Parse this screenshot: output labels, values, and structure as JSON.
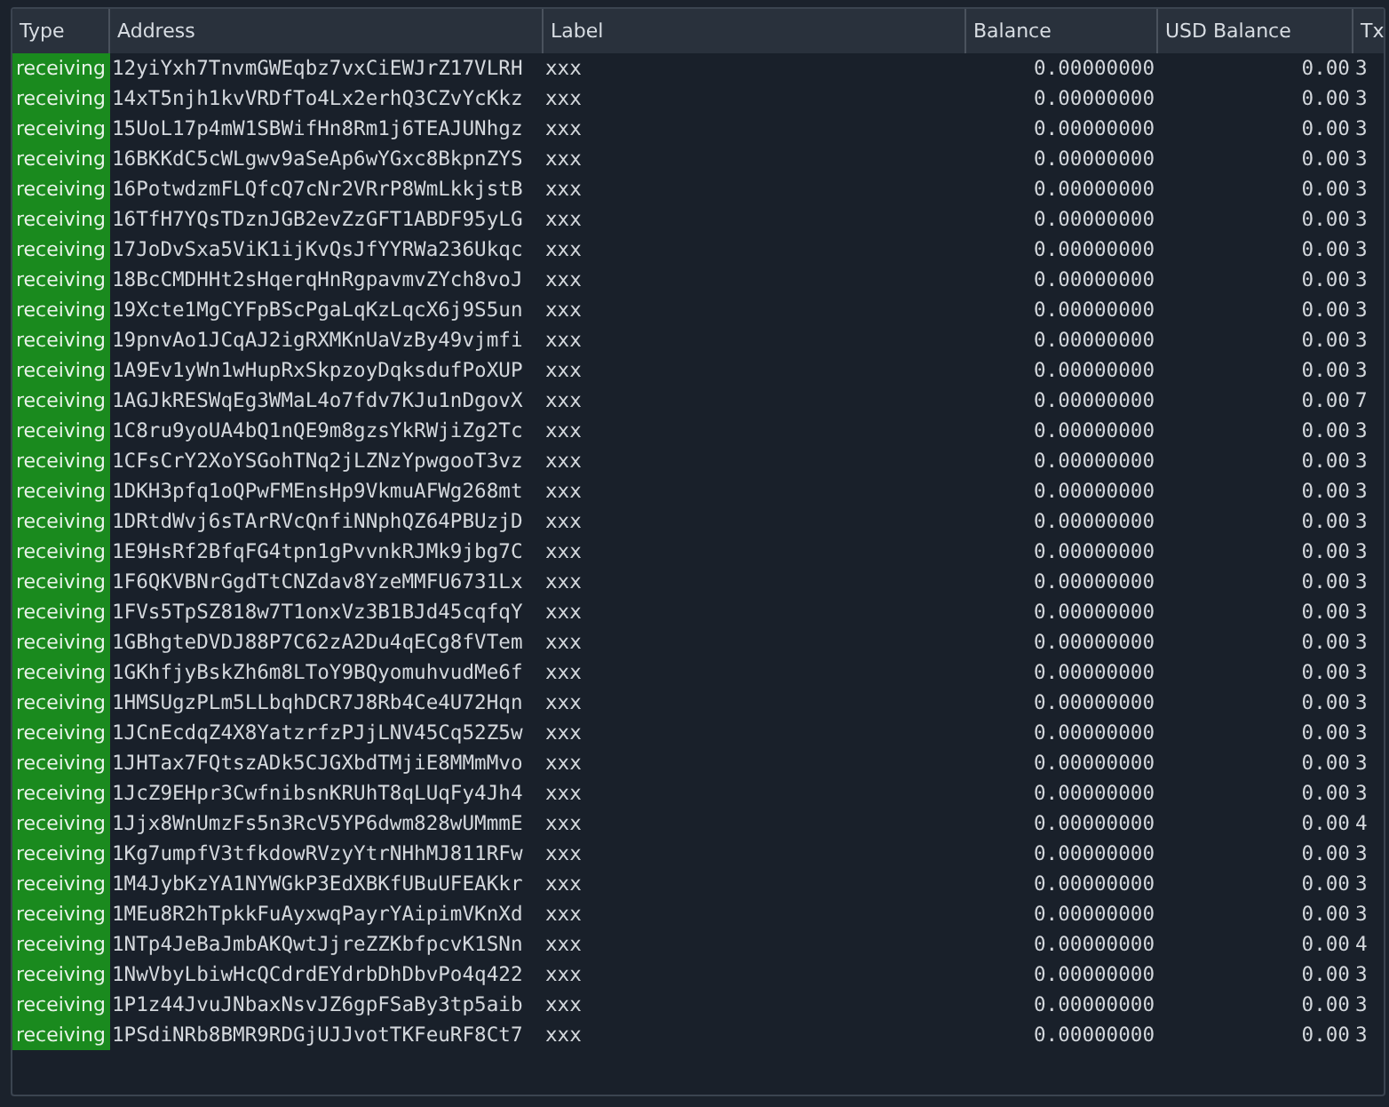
{
  "table": {
    "columns": [
      "Type",
      "Address",
      "Label",
      "Balance",
      "USD Balance",
      "Tx"
    ],
    "rows": [
      {
        "type": "receiving",
        "address": "12yiYxh7TnvmGWEqbz7vxCiEWJrZ17VLRH",
        "label": "xxx",
        "balance": "0.00000000",
        "usd_balance": "0.00",
        "tx": "3"
      },
      {
        "type": "receiving",
        "address": "14xT5njh1kvVRDfTo4Lx2erhQ3CZvYcKkz",
        "label": "xxx",
        "balance": "0.00000000",
        "usd_balance": "0.00",
        "tx": "3"
      },
      {
        "type": "receiving",
        "address": "15UoL17p4mW1SBWifHn8Rm1j6TEAJUNhgz",
        "label": "xxx",
        "balance": "0.00000000",
        "usd_balance": "0.00",
        "tx": "3"
      },
      {
        "type": "receiving",
        "address": "16BKKdC5cWLgwv9aSeAp6wYGxc8BkpnZYS",
        "label": "xxx",
        "balance": "0.00000000",
        "usd_balance": "0.00",
        "tx": "3"
      },
      {
        "type": "receiving",
        "address": "16PotwdzmFLQfcQ7cNr2VRrP8WmLkkjstB",
        "label": "xxx",
        "balance": "0.00000000",
        "usd_balance": "0.00",
        "tx": "3"
      },
      {
        "type": "receiving",
        "address": "16TfH7YQsTDznJGB2evZzGFT1ABDF95yLG",
        "label": "xxx",
        "balance": "0.00000000",
        "usd_balance": "0.00",
        "tx": "3"
      },
      {
        "type": "receiving",
        "address": "17JoDvSxa5ViK1ijKvQsJfYYRWa236Ukqc",
        "label": "xxx",
        "balance": "0.00000000",
        "usd_balance": "0.00",
        "tx": "3"
      },
      {
        "type": "receiving",
        "address": "18BcCMDHHt2sHqerqHnRgpavmvZYch8voJ",
        "label": "xxx",
        "balance": "0.00000000",
        "usd_balance": "0.00",
        "tx": "3"
      },
      {
        "type": "receiving",
        "address": "19Xcte1MgCYFpBScPgaLqKzLqcX6j9S5un",
        "label": "xxx",
        "balance": "0.00000000",
        "usd_balance": "0.00",
        "tx": "3"
      },
      {
        "type": "receiving",
        "address": "19pnvAo1JCqAJ2igRXMKnUaVzBy49vjmfi",
        "label": "xxx",
        "balance": "0.00000000",
        "usd_balance": "0.00",
        "tx": "3"
      },
      {
        "type": "receiving",
        "address": "1A9Ev1yWn1wHupRxSkpzoyDqksdufPoXUP",
        "label": "xxx",
        "balance": "0.00000000",
        "usd_balance": "0.00",
        "tx": "3"
      },
      {
        "type": "receiving",
        "address": "1AGJkRESWqEg3WMaL4o7fdv7KJu1nDgovX",
        "label": "xxx",
        "balance": "0.00000000",
        "usd_balance": "0.00",
        "tx": "7"
      },
      {
        "type": "receiving",
        "address": "1C8ru9yoUA4bQ1nQE9m8gzsYkRWjiZg2Tc",
        "label": "xxx",
        "balance": "0.00000000",
        "usd_balance": "0.00",
        "tx": "3"
      },
      {
        "type": "receiving",
        "address": "1CFsCrY2XoYSGohTNq2jLZNzYpwgooT3vz",
        "label": "xxx",
        "balance": "0.00000000",
        "usd_balance": "0.00",
        "tx": "3"
      },
      {
        "type": "receiving",
        "address": "1DKH3pfq1oQPwFMEnsHp9VkmuAFWg268mt",
        "label": "xxx",
        "balance": "0.00000000",
        "usd_balance": "0.00",
        "tx": "3"
      },
      {
        "type": "receiving",
        "address": "1DRtdWvj6sTArRVcQnfiNNphQZ64PBUzjD",
        "label": "xxx",
        "balance": "0.00000000",
        "usd_balance": "0.00",
        "tx": "3"
      },
      {
        "type": "receiving",
        "address": "1E9HsRf2BfqFG4tpn1gPvvnkRJMk9jbg7C",
        "label": "xxx",
        "balance": "0.00000000",
        "usd_balance": "0.00",
        "tx": "3"
      },
      {
        "type": "receiving",
        "address": "1F6QKVBNrGgdTtCNZdav8YzeMMFU6731Lx",
        "label": "xxx",
        "balance": "0.00000000",
        "usd_balance": "0.00",
        "tx": "3"
      },
      {
        "type": "receiving",
        "address": "1FVs5TpSZ818w7T1onxVz3B1BJd45cqfqY",
        "label": "xxx",
        "balance": "0.00000000",
        "usd_balance": "0.00",
        "tx": "3"
      },
      {
        "type": "receiving",
        "address": "1GBhgteDVDJ88P7C62zA2Du4qECg8fVTem",
        "label": "xxx",
        "balance": "0.00000000",
        "usd_balance": "0.00",
        "tx": "3"
      },
      {
        "type": "receiving",
        "address": "1GKhfjyBskZh6m8LToY9BQyomuhvudMe6f",
        "label": "xxx",
        "balance": "0.00000000",
        "usd_balance": "0.00",
        "tx": "3"
      },
      {
        "type": "receiving",
        "address": "1HMSUgzPLm5LLbqhDCR7J8Rb4Ce4U72Hqn",
        "label": "xxx",
        "balance": "0.00000000",
        "usd_balance": "0.00",
        "tx": "3"
      },
      {
        "type": "receiving",
        "address": "1JCnEcdqZ4X8YatzrfzPJjLNV45Cq52Z5w",
        "label": "xxx",
        "balance": "0.00000000",
        "usd_balance": "0.00",
        "tx": "3"
      },
      {
        "type": "receiving",
        "address": "1JHTax7FQtszADk5CJGXbdTMjiE8MMmMvo",
        "label": "xxx",
        "balance": "0.00000000",
        "usd_balance": "0.00",
        "tx": "3"
      },
      {
        "type": "receiving",
        "address": "1JcZ9EHpr3CwfnibsnKRUhT8qLUqFy4Jh4",
        "label": "xxx",
        "balance": "0.00000000",
        "usd_balance": "0.00",
        "tx": "3"
      },
      {
        "type": "receiving",
        "address": "1Jjx8WnUmzFs5n3RcV5YP6dwm828wUMmmE",
        "label": "xxx",
        "balance": "0.00000000",
        "usd_balance": "0.00",
        "tx": "4"
      },
      {
        "type": "receiving",
        "address": "1Kg7umpfV3tfkdowRVzyYtrNHhMJ811RFw",
        "label": "xxx",
        "balance": "0.00000000",
        "usd_balance": "0.00",
        "tx": "3"
      },
      {
        "type": "receiving",
        "address": "1M4JybKzYA1NYWGkP3EdXBKfUBuUFEAKkr",
        "label": "xxx",
        "balance": "0.00000000",
        "usd_balance": "0.00",
        "tx": "3"
      },
      {
        "type": "receiving",
        "address": "1MEu8R2hTpkkFuAyxwqPayrYAipimVKnXd",
        "label": "xxx",
        "balance": "0.00000000",
        "usd_balance": "0.00",
        "tx": "3"
      },
      {
        "type": "receiving",
        "address": "1NTp4JeBaJmbAKQwtJjreZZKbfpcvK1SNn",
        "label": "xxx",
        "balance": "0.00000000",
        "usd_balance": "0.00",
        "tx": "4"
      },
      {
        "type": "receiving",
        "address": "1NwVbyLbiwHcQCdrdEYdrbDhDbvPo4q422",
        "label": "xxx",
        "balance": "0.00000000",
        "usd_balance": "0.00",
        "tx": "3"
      },
      {
        "type": "receiving",
        "address": "1P1z44JvuJNbaxNsvJZ6gpFSaBy3tp5aib",
        "label": "xxx",
        "balance": "0.00000000",
        "usd_balance": "0.00",
        "tx": "3"
      },
      {
        "type": "receiving",
        "address": "1PSdiNRb8BMR9RDGjUJJvotTKFeuRF8Ct7",
        "label": "xxx",
        "balance": "0.00000000",
        "usd_balance": "0.00",
        "tx": "3"
      }
    ]
  }
}
